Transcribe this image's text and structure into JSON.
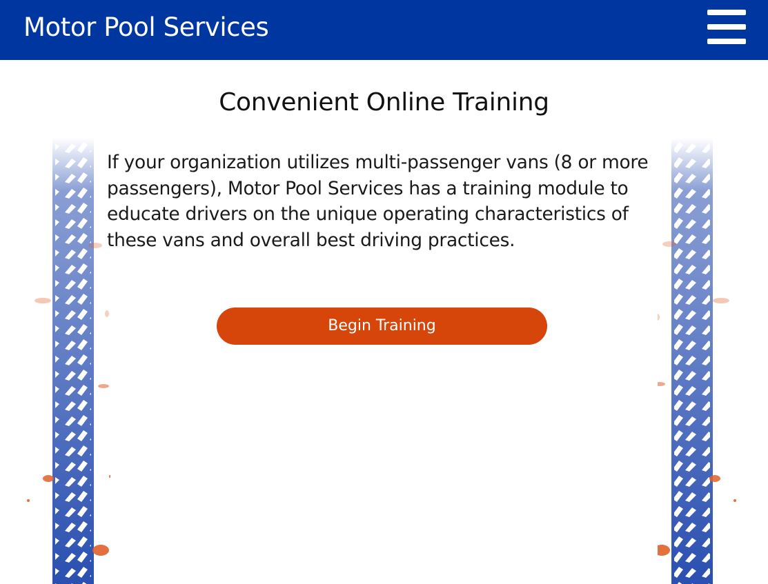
{
  "header": {
    "brand": "Motor Pool Services",
    "menu_icon": "hamburger-menu-icon",
    "background_color": "#0036a0"
  },
  "main": {
    "title": "Convenient Online Training",
    "description": "If your organization utilizes multi-passenger vans (8 or more passengers), Motor Pool Services has a training module to educate drivers on the unique operating characteristics of these vans and overall best driving practices.",
    "cta_label": "Begin Training",
    "cta_color": "#d6450a"
  },
  "decoration": {
    "icon": "tire-track-icon",
    "track_color": "#2a4fb0",
    "splatter_color": "#e0602a"
  }
}
